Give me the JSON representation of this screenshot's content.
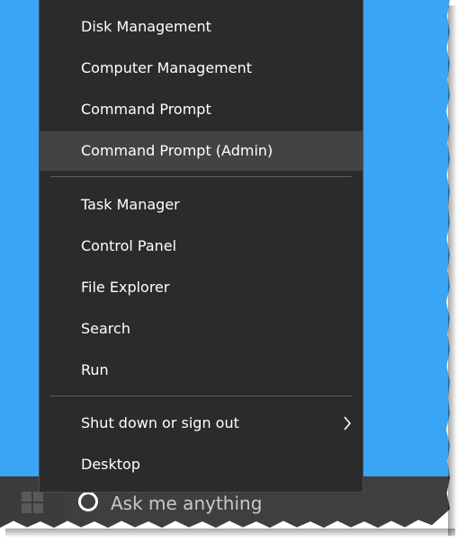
{
  "menu": {
    "items": [
      {
        "label": "Disk Management"
      },
      {
        "label": "Computer Management"
      },
      {
        "label": "Command Prompt"
      },
      {
        "label": "Command Prompt (Admin)"
      },
      {
        "label": "Task Manager"
      },
      {
        "label": "Control Panel"
      },
      {
        "label": "File Explorer"
      },
      {
        "label": "Search"
      },
      {
        "label": "Run"
      },
      {
        "label": "Shut down or sign out",
        "submenu_icon": "chevron-right-icon"
      },
      {
        "label": "Desktop"
      }
    ]
  },
  "taskbar": {
    "start_icon": "windows-logo-icon",
    "search_icon": "cortana-icon",
    "search_placeholder": "Ask me anything"
  },
  "colors": {
    "desktop": "#3aa5f5",
    "menu_bg": "#2b2b2b",
    "menu_highlight": "#434343",
    "taskbar_bg": "#2b2b2b",
    "text": "#ffffff"
  }
}
